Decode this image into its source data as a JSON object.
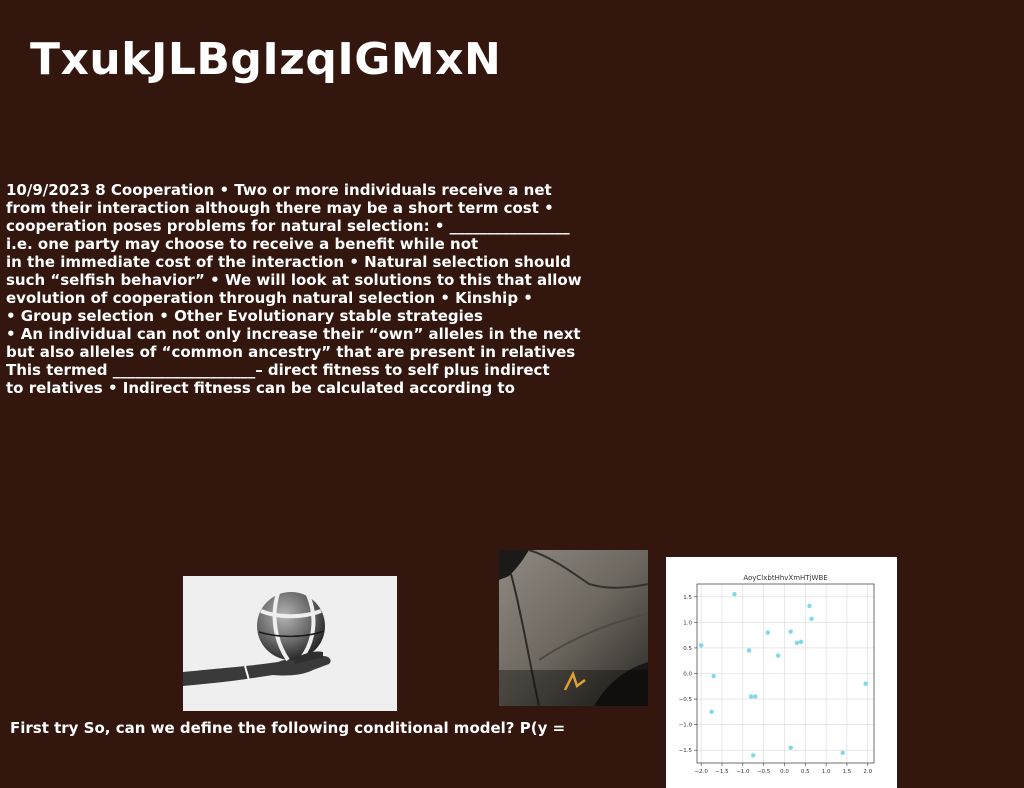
{
  "title": "TxukJLBgIzqIGMxN",
  "body_lines": [
    "10/9/2023 8 Cooperation • Two or more individuals receive a net",
    "from their interaction although there may be a short term cost •",
    "cooperation poses problems for natural selection: • ________________",
    "i.e. one party may choose to receive a benefit while not",
    "in the immediate cost of the interaction • Natural selection should",
    "such “selfish behavior” • We will look at solutions to this that allow",
    "evolution of cooperation through natural selection • Kinship •",
    "• Group selection • Other Evolutionary stable strategies",
    "• An individual can not only increase their “own” alleles in the next",
    "but also alleles of “common ancestry” that are present in relatives",
    "This termed ___________________– direct fitness to self plus indirect",
    "to relatives • Indirect fitness can be calculated according to"
  ],
  "caption": "First try So, can we define the following conditional model? P(y =",
  "colors": {
    "background": "#33170f",
    "text": "#ffffff",
    "point": "#7fd8e8"
  },
  "chart_data": {
    "type": "scatter",
    "title": "AoyClxbtHhvXmHTjWBE",
    "xlabel": "",
    "ylabel": "",
    "xlim": [
      -2.1,
      2.15
    ],
    "ylim": [
      -1.75,
      1.75
    ],
    "grid": true,
    "xticks": [
      -2.0,
      -1.5,
      -1.0,
      -0.5,
      0.0,
      0.5,
      1.0,
      1.5,
      2.0
    ],
    "yticks": [
      -1.5,
      -1.0,
      -0.5,
      0.0,
      0.5,
      1.0,
      1.5
    ],
    "x": [
      -2.0,
      -1.7,
      -1.75,
      -1.2,
      -0.85,
      -0.75,
      -0.7,
      -0.4,
      -0.15,
      0.15,
      0.15,
      0.4,
      0.6,
      0.65,
      1.4,
      1.95,
      -0.8,
      0.3
    ],
    "y": [
      0.55,
      -0.05,
      -0.75,
      1.55,
      0.45,
      -1.6,
      -0.45,
      0.8,
      0.35,
      0.82,
      -1.45,
      0.62,
      1.32,
      1.07,
      -1.55,
      -0.2,
      -0.45,
      0.6
    ]
  }
}
